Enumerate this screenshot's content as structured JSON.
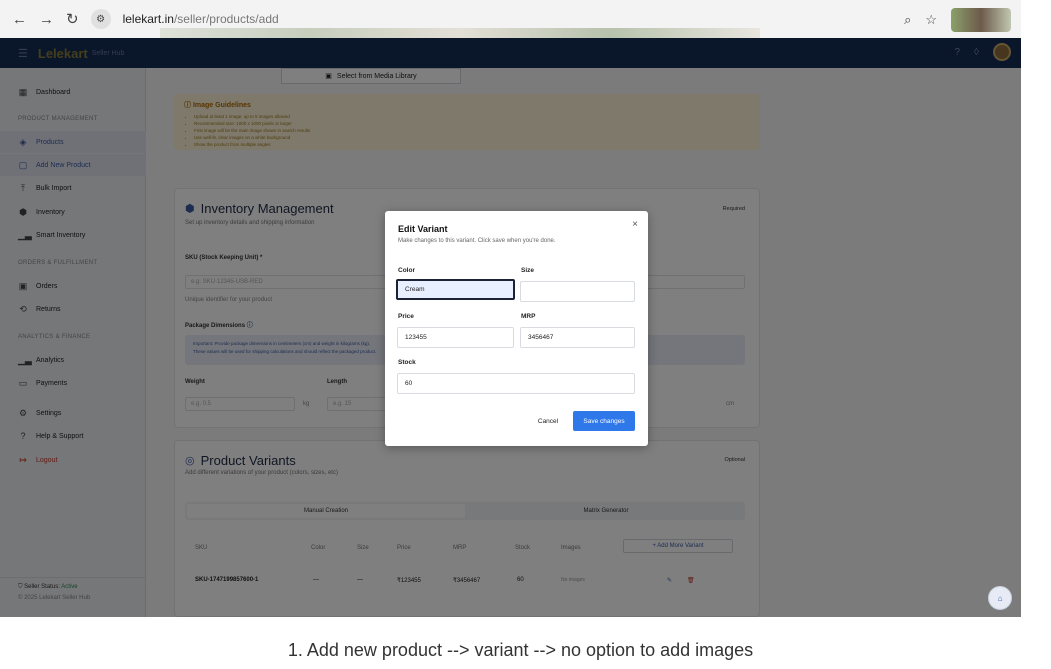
{
  "browser": {
    "url_domain": "lelekart.in",
    "url_path": "/seller/products/add"
  },
  "app": {
    "brand": "Lelekart",
    "brand_sub": "Seller Hub"
  },
  "sidebar": {
    "items": [
      {
        "label": "Dashboard",
        "icon": "grid-icon"
      },
      {
        "label": "Products",
        "icon": "box-icon"
      },
      {
        "label": "Add New Product",
        "icon": "plus-square-icon"
      },
      {
        "label": "Bulk Import",
        "icon": "upload-icon"
      },
      {
        "label": "Inventory",
        "icon": "stack-icon"
      },
      {
        "label": "Smart Inventory",
        "icon": "bar-chart-icon"
      },
      {
        "label": "Orders",
        "icon": "calendar-icon"
      },
      {
        "label": "Returns",
        "icon": "return-icon"
      },
      {
        "label": "Analytics",
        "icon": "bar-chart-icon"
      },
      {
        "label": "Payments",
        "icon": "card-icon"
      },
      {
        "label": "Settings",
        "icon": "gear-icon"
      },
      {
        "label": "Help & Support",
        "icon": "help-icon"
      },
      {
        "label": "Logout",
        "icon": "logout-icon"
      }
    ],
    "sections": {
      "product": "PRODUCT MANAGEMENT",
      "orders": "ORDERS & FULFILLMENT",
      "analytics": "ANALYTICS & FINANCE"
    },
    "footer": {
      "status_label": "Seller Status:",
      "status_value": "Active",
      "copyright": "© 2025 Lelekart Seller Hub"
    }
  },
  "media": {
    "select_label": "Select from Media Library"
  },
  "guidelines": {
    "title": "Image Guidelines",
    "items": [
      "Upload at least 1 image, up to 5 images allowed",
      "Recommended size: 1000 x 1000 pixels or larger",
      "First image will be the main image shown in search results",
      "Use well-lit, clear images on a white background",
      "Show the product from multiple angles"
    ]
  },
  "inventory": {
    "title": "Inventory Management",
    "subtitle": "Set up inventory details and shipping information",
    "badge": "Required",
    "sku_label": "SKU (Stock Keeping Unit) *",
    "sku_placeholder": "e.g. SKU-12345-USB-RED",
    "sku_help": "Unique identifier for your product",
    "package_label": "Package Dimensions",
    "important_line1": "Important: Provide package dimensions in centimeters (cm) and weight in kilograms (kg).",
    "important_line2": "These values will be used for shipping calculations and should reflect the packaged product.",
    "weight_label": "Weight",
    "weight_placeholder": "e.g. 0.5",
    "weight_unit": "kg",
    "length_label": "Length",
    "length_placeholder": "e.g. 15",
    "cm_unit": "cm"
  },
  "variants": {
    "title": "Product Variants",
    "subtitle": "Add different variations of your product (colors, sizes, etc)",
    "badge": "Optional",
    "tab_manual": "Manual Creation",
    "tab_matrix": "Matrix Generator",
    "add_more": "+ Add More Variant",
    "columns": [
      "SKU",
      "Color",
      "Size",
      "Price",
      "MRP",
      "Stock",
      "Images"
    ],
    "row": {
      "sku": "SKU-1747199857600-1",
      "color": "—",
      "size": "—",
      "price": "₹123455",
      "mrp": "₹3456467",
      "stock": "60",
      "images": "No images"
    }
  },
  "modal": {
    "title": "Edit Variant",
    "description": "Make changes to this variant. Click save when you're done.",
    "color_label": "Color",
    "color_value": "Cream",
    "size_label": "Size",
    "size_value": "",
    "price_label": "Price",
    "price_value": "123455",
    "mrp_label": "MRP",
    "mrp_value": "3456467",
    "stock_label": "Stock",
    "stock_value": "60",
    "cancel": "Cancel",
    "save": "Save changes"
  },
  "caption": "1. Add new product --> variant --> no option to add images"
}
